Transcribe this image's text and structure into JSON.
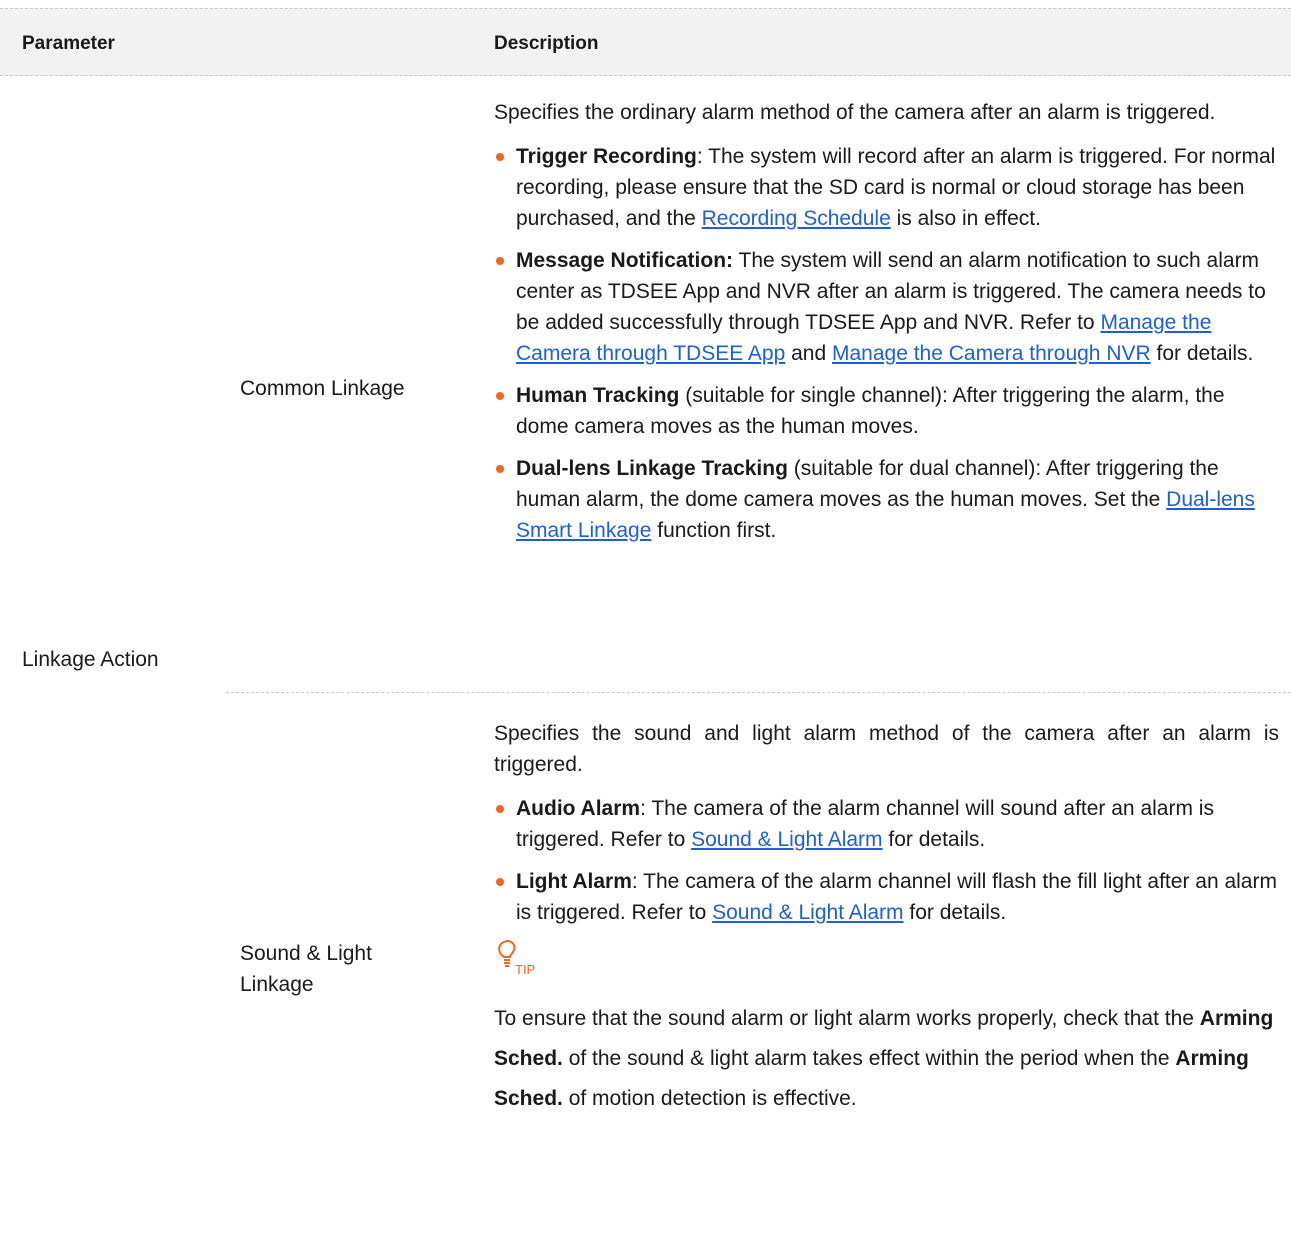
{
  "table": {
    "header": {
      "parameter": "Parameter",
      "description": "Description"
    },
    "parameter": "Linkage Action",
    "common_linkage": {
      "label": "Common Linkage",
      "intro": "Specifies the ordinary alarm method of the camera after an alarm is triggered.",
      "trigger_recording": {
        "term": "Trigger Recording",
        "text": ": The system will record after an alarm is triggered. For normal recording, please ensure that the SD card is normal or cloud storage has been purchased, and the ",
        "link": "Recording Schedule",
        "text_after": " is also in effect."
      },
      "message_notification": {
        "term": "Message Notification:",
        "text": " The system will send an alarm notification to such alarm center as TDSEE App and NVR after an alarm is triggered. The camera needs to be added successfully through TDSEE App and NVR. Refer to ",
        "link1": "Manage the Camera through TDSEE App",
        "text_mid": " and ",
        "link2": "Manage the Camera through NVR",
        "text_after": " for details."
      },
      "human_tracking": {
        "term": "Human Tracking",
        "text": " (suitable for single channel): After triggering the alarm, the dome camera moves as the human moves."
      },
      "dual_lens_tracking": {
        "term": "Dual-lens Linkage Tracking",
        "text": " (suitable for dual channel): After triggering the human alarm, the dome camera moves as the human moves. Set the ",
        "link": "Dual-lens Smart Linkage",
        "text_after": " function first."
      }
    },
    "sound_light_linkage": {
      "label": "Sound & Light Linkage",
      "intro": "Specifies the sound and light alarm method of the camera after an alarm is triggered.",
      "audio_alarm": {
        "term": "Audio Alarm",
        "text": ": The camera of the alarm channel will sound after an alarm is triggered. Refer to ",
        "link": "Sound & Light Alarm",
        "text_after": " for details."
      },
      "light_alarm": {
        "term": "Light Alarm",
        "text": ": The camera of the alarm channel will flash the fill light after an alarm is triggered. Refer to ",
        "link": "Sound & Light Alarm",
        "text_after": " for details."
      },
      "tip": {
        "label": "TIP",
        "text1": "To ensure that the sound alarm or light alarm works properly, check that the ",
        "bold1": "Arming Sched.",
        "text2": " of the sound & light alarm takes effect within the period when the ",
        "bold2": "Arming Sched.",
        "text3": " of motion detection is effective."
      }
    }
  },
  "colors": {
    "bullet": "#f26522",
    "link": "#1f5fd6",
    "header_bg": "#f2f2f2",
    "tip_accent": "#f26522"
  },
  "icons": {
    "tip": "lightbulb-icon",
    "bullet": "bullet-dot"
  }
}
